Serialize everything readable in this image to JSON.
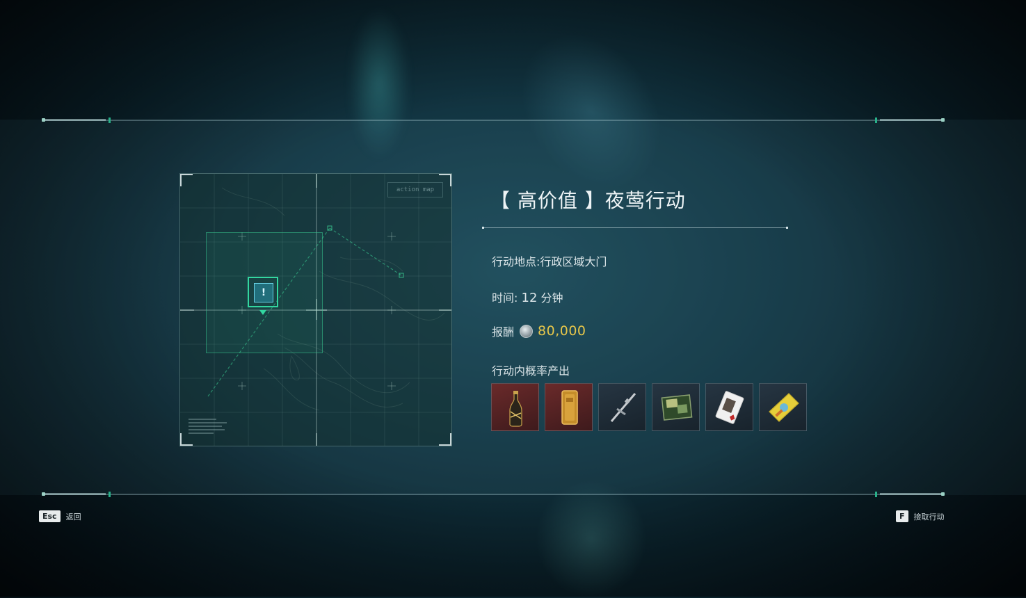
{
  "mission": {
    "title": "【 高价值 】夜莺行动",
    "location_label": "行动地点:",
    "location_value": "行政区域大门",
    "time_label": "时间:",
    "time_value": "12",
    "time_unit": "分钟",
    "reward_label": "报酬",
    "reward_value": "80,000",
    "drops_label": "行动内概率产出",
    "drops": [
      {
        "icon": "champagne-bottle-icon",
        "rarity": "red"
      },
      {
        "icon": "gold-bar-icon",
        "rarity": "red"
      },
      {
        "icon": "rifle-icon",
        "rarity": "dark"
      },
      {
        "icon": "photo-album-icon",
        "rarity": "dark"
      },
      {
        "icon": "playing-card-icon",
        "rarity": "dark"
      },
      {
        "icon": "snack-bag-icon",
        "rarity": "dark"
      }
    ]
  },
  "map": {
    "tag": "action map",
    "marker_icon": "mission-marker-icon"
  },
  "footer": {
    "back_key": "Esc",
    "back_label": "返回",
    "accept_key": "F",
    "accept_label": "接取行动"
  },
  "colors": {
    "accent_green": "#33d6a0",
    "reward_gold": "#e6c64a",
    "rarity_red": "#6a2a2a"
  }
}
